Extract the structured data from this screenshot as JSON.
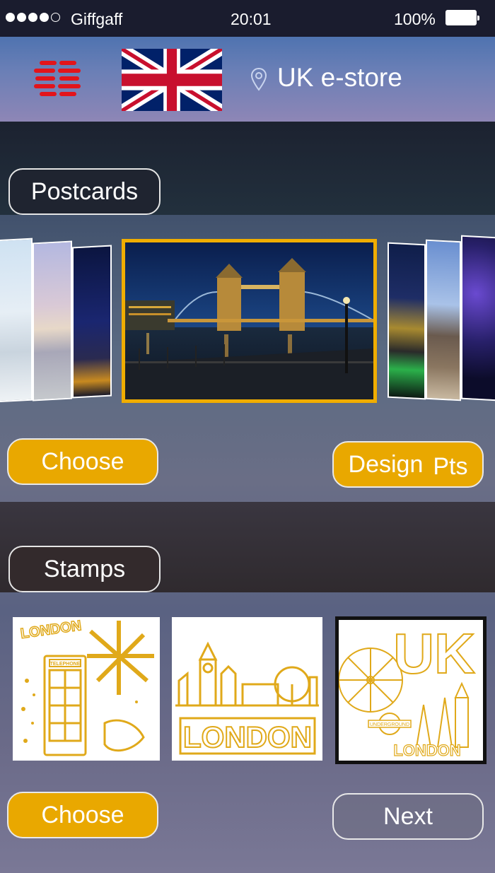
{
  "status_bar": {
    "carrier": "Giffgaff",
    "time": "20:01",
    "battery": "100%"
  },
  "header": {
    "title": "UK e-store",
    "menu_icon": "menu-icon",
    "flag_icon": "union-jack-flag-icon",
    "location_icon": "location-pin-icon"
  },
  "postcards": {
    "section_label": "Postcards",
    "choose_label": "Choose",
    "design_label": "Design",
    "design_pts_label": "Pts"
  },
  "stamps": {
    "section_label": "Stamps",
    "choose_label": "Choose",
    "next_label": "Next",
    "items": [
      {
        "text": "LONDON",
        "sub": "TELEPHONE"
      },
      {
        "text": "LONDON"
      },
      {
        "text": "UK",
        "sub": "LONDON",
        "roundel": "UNDERGROUND"
      }
    ]
  },
  "colors": {
    "accent": "#e9a800",
    "header": "#5f78b2",
    "stamp_line": "#e0a91a"
  }
}
